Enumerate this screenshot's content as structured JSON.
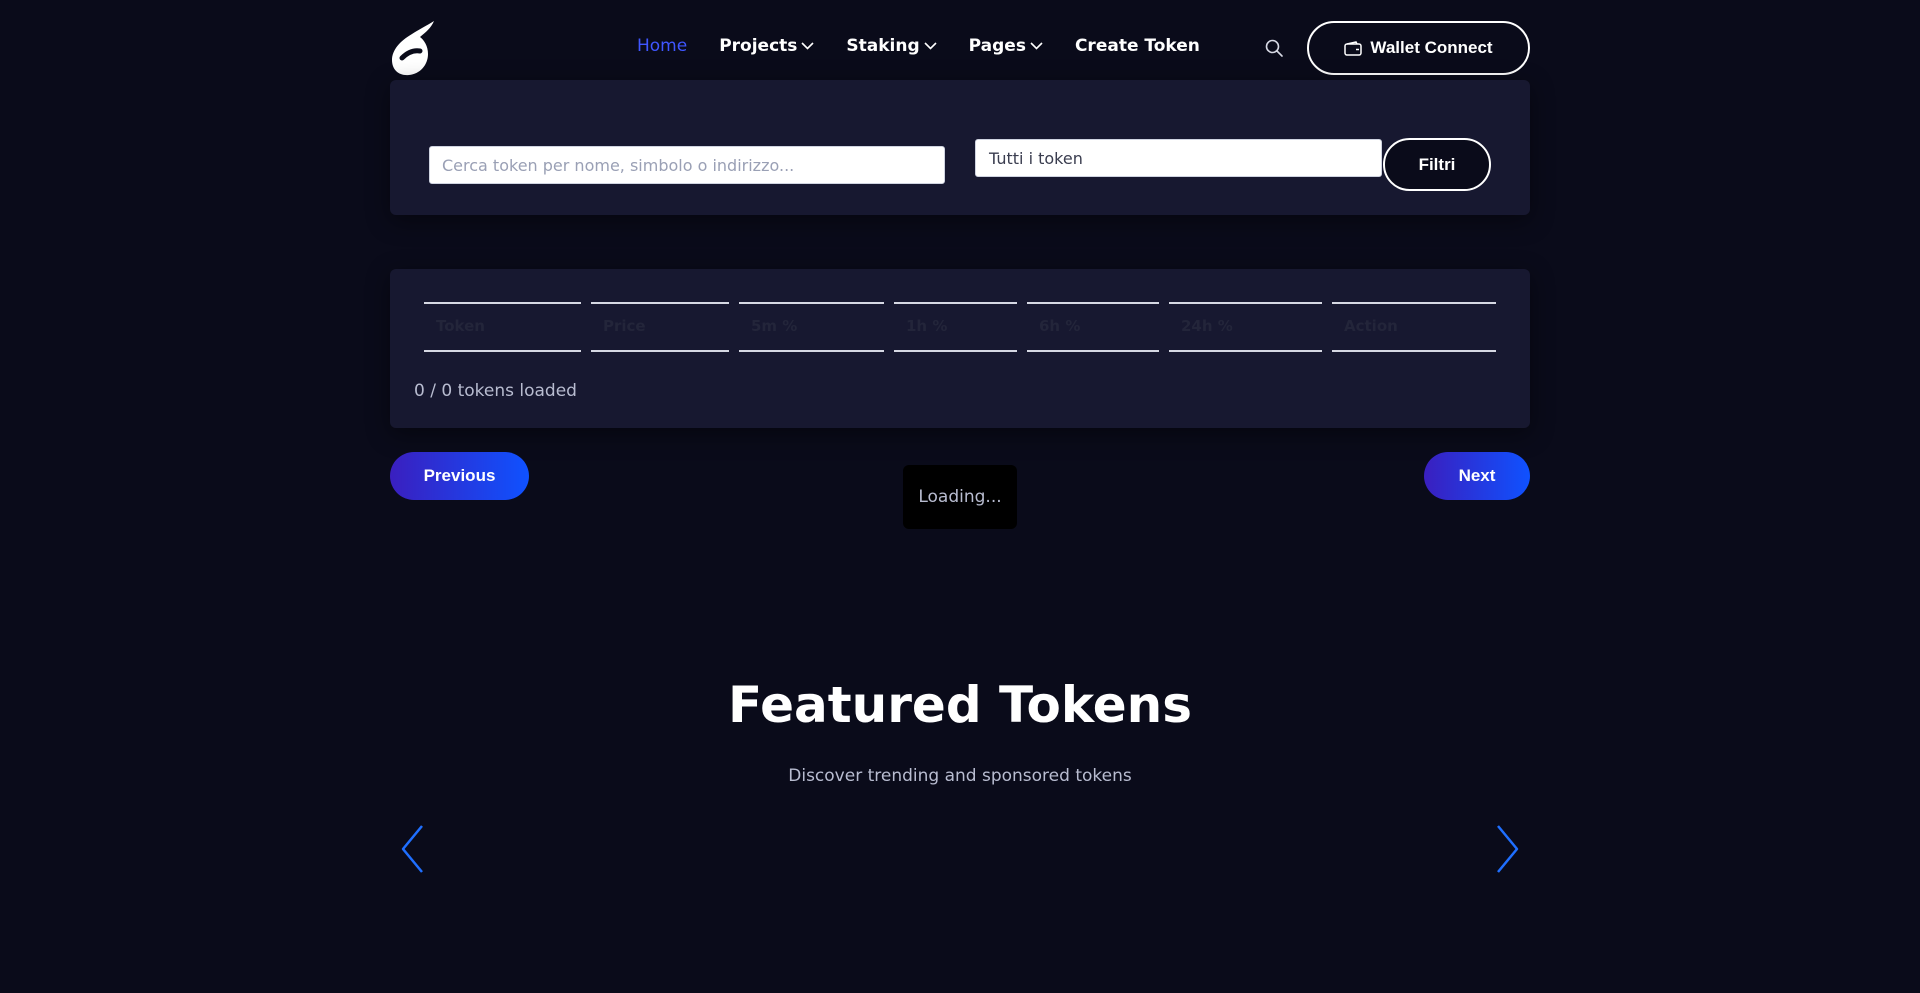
{
  "header": {
    "nav": [
      {
        "label": "Home",
        "active": true,
        "dropdown": false
      },
      {
        "label": "Projects",
        "active": false,
        "dropdown": true
      },
      {
        "label": "Staking",
        "active": false,
        "dropdown": true
      },
      {
        "label": "Pages",
        "active": false,
        "dropdown": true
      },
      {
        "label": "Create Token",
        "active": false,
        "dropdown": false
      }
    ],
    "search_icon": "search-icon",
    "wallet_icon": "wallet-icon",
    "wallet_label": "Wallet Connect"
  },
  "filters": {
    "search_placeholder": "Cerca token per nome, simbolo o indirizzo...",
    "search_value": "",
    "select_value": "Tutti i token",
    "filter_button": "Filtri"
  },
  "table": {
    "columns": [
      "Token",
      "Price",
      "5m %",
      "1h %",
      "6h %",
      "24h %",
      "Action"
    ],
    "rows": [],
    "loaded_text": "0 / 0 tokens loaded"
  },
  "pagination": {
    "previous": "Previous",
    "next": "Next",
    "loading": "Loading..."
  },
  "featured": {
    "title": "Featured Tokens",
    "subtitle": "Discover trending and sponsored tokens",
    "prev_icon": "chevron-left-icon",
    "next_icon": "chevron-right-icon"
  },
  "colors": {
    "background": "#0a0b1a",
    "panel": "#171830",
    "accent": "#3f56ff",
    "arrow": "#1f6fff"
  }
}
